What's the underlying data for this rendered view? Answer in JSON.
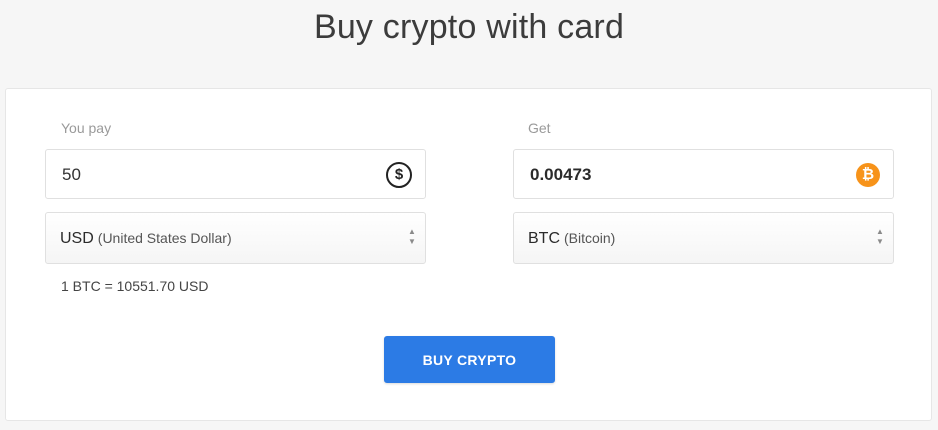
{
  "header": {
    "title": "Buy crypto with card"
  },
  "pay": {
    "label": "You pay",
    "amount": "50",
    "currency_code": "USD",
    "currency_name": "(United States Dollar)",
    "icon": "dollar-icon"
  },
  "get": {
    "label": "Get",
    "amount": "0.00473",
    "currency_code": "BTC",
    "currency_name": "(Bitcoin)",
    "icon": "bitcoin-icon",
    "icon_color": "#f7931a"
  },
  "rate_text": "1 BTC = 10551.70 USD",
  "buy_button": {
    "label": "BUY CRYPTO",
    "color": "#2c7be5"
  },
  "glyphs": {
    "dollar": "$",
    "bitcoin": "₿",
    "arrow_up": "▲",
    "arrow_down": "▼"
  }
}
